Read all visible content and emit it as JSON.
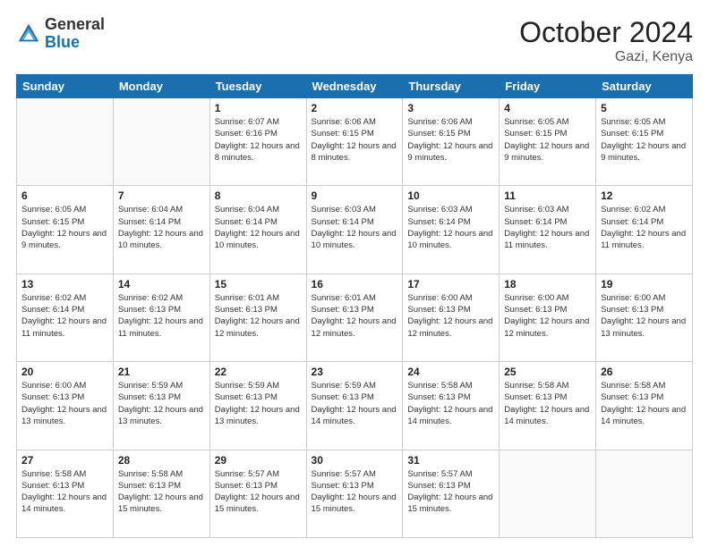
{
  "logo": {
    "general": "General",
    "blue": "Blue"
  },
  "title": {
    "month": "October 2024",
    "location": "Gazi, Kenya"
  },
  "weekdays": [
    "Sunday",
    "Monday",
    "Tuesday",
    "Wednesday",
    "Thursday",
    "Friday",
    "Saturday"
  ],
  "weeks": [
    [
      {
        "day": "",
        "info": ""
      },
      {
        "day": "",
        "info": ""
      },
      {
        "day": "1",
        "info": "Sunrise: 6:07 AM\nSunset: 6:16 PM\nDaylight: 12 hours and 8 minutes."
      },
      {
        "day": "2",
        "info": "Sunrise: 6:06 AM\nSunset: 6:15 PM\nDaylight: 12 hours and 8 minutes."
      },
      {
        "day": "3",
        "info": "Sunrise: 6:06 AM\nSunset: 6:15 PM\nDaylight: 12 hours and 9 minutes."
      },
      {
        "day": "4",
        "info": "Sunrise: 6:05 AM\nSunset: 6:15 PM\nDaylight: 12 hours and 9 minutes."
      },
      {
        "day": "5",
        "info": "Sunrise: 6:05 AM\nSunset: 6:15 PM\nDaylight: 12 hours and 9 minutes."
      }
    ],
    [
      {
        "day": "6",
        "info": "Sunrise: 6:05 AM\nSunset: 6:15 PM\nDaylight: 12 hours and 9 minutes."
      },
      {
        "day": "7",
        "info": "Sunrise: 6:04 AM\nSunset: 6:14 PM\nDaylight: 12 hours and 10 minutes."
      },
      {
        "day": "8",
        "info": "Sunrise: 6:04 AM\nSunset: 6:14 PM\nDaylight: 12 hours and 10 minutes."
      },
      {
        "day": "9",
        "info": "Sunrise: 6:03 AM\nSunset: 6:14 PM\nDaylight: 12 hours and 10 minutes."
      },
      {
        "day": "10",
        "info": "Sunrise: 6:03 AM\nSunset: 6:14 PM\nDaylight: 12 hours and 10 minutes."
      },
      {
        "day": "11",
        "info": "Sunrise: 6:03 AM\nSunset: 6:14 PM\nDaylight: 12 hours and 11 minutes."
      },
      {
        "day": "12",
        "info": "Sunrise: 6:02 AM\nSunset: 6:14 PM\nDaylight: 12 hours and 11 minutes."
      }
    ],
    [
      {
        "day": "13",
        "info": "Sunrise: 6:02 AM\nSunset: 6:14 PM\nDaylight: 12 hours and 11 minutes."
      },
      {
        "day": "14",
        "info": "Sunrise: 6:02 AM\nSunset: 6:13 PM\nDaylight: 12 hours and 11 minutes."
      },
      {
        "day": "15",
        "info": "Sunrise: 6:01 AM\nSunset: 6:13 PM\nDaylight: 12 hours and 12 minutes."
      },
      {
        "day": "16",
        "info": "Sunrise: 6:01 AM\nSunset: 6:13 PM\nDaylight: 12 hours and 12 minutes."
      },
      {
        "day": "17",
        "info": "Sunrise: 6:00 AM\nSunset: 6:13 PM\nDaylight: 12 hours and 12 minutes."
      },
      {
        "day": "18",
        "info": "Sunrise: 6:00 AM\nSunset: 6:13 PM\nDaylight: 12 hours and 12 minutes."
      },
      {
        "day": "19",
        "info": "Sunrise: 6:00 AM\nSunset: 6:13 PM\nDaylight: 12 hours and 13 minutes."
      }
    ],
    [
      {
        "day": "20",
        "info": "Sunrise: 6:00 AM\nSunset: 6:13 PM\nDaylight: 12 hours and 13 minutes."
      },
      {
        "day": "21",
        "info": "Sunrise: 5:59 AM\nSunset: 6:13 PM\nDaylight: 12 hours and 13 minutes."
      },
      {
        "day": "22",
        "info": "Sunrise: 5:59 AM\nSunset: 6:13 PM\nDaylight: 12 hours and 13 minutes."
      },
      {
        "day": "23",
        "info": "Sunrise: 5:59 AM\nSunset: 6:13 PM\nDaylight: 12 hours and 14 minutes."
      },
      {
        "day": "24",
        "info": "Sunrise: 5:58 AM\nSunset: 6:13 PM\nDaylight: 12 hours and 14 minutes."
      },
      {
        "day": "25",
        "info": "Sunrise: 5:58 AM\nSunset: 6:13 PM\nDaylight: 12 hours and 14 minutes."
      },
      {
        "day": "26",
        "info": "Sunrise: 5:58 AM\nSunset: 6:13 PM\nDaylight: 12 hours and 14 minutes."
      }
    ],
    [
      {
        "day": "27",
        "info": "Sunrise: 5:58 AM\nSunset: 6:13 PM\nDaylight: 12 hours and 14 minutes."
      },
      {
        "day": "28",
        "info": "Sunrise: 5:58 AM\nSunset: 6:13 PM\nDaylight: 12 hours and 15 minutes."
      },
      {
        "day": "29",
        "info": "Sunrise: 5:57 AM\nSunset: 6:13 PM\nDaylight: 12 hours and 15 minutes."
      },
      {
        "day": "30",
        "info": "Sunrise: 5:57 AM\nSunset: 6:13 PM\nDaylight: 12 hours and 15 minutes."
      },
      {
        "day": "31",
        "info": "Sunrise: 5:57 AM\nSunset: 6:13 PM\nDaylight: 12 hours and 15 minutes."
      },
      {
        "day": "",
        "info": ""
      },
      {
        "day": "",
        "info": ""
      }
    ]
  ]
}
